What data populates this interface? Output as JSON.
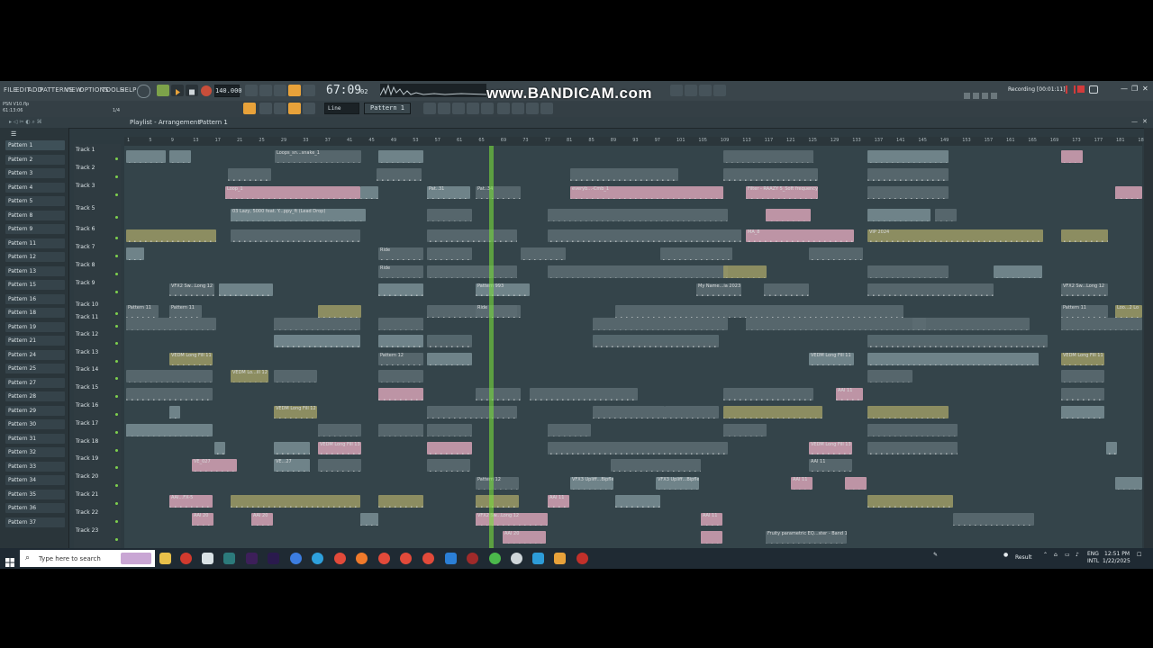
{
  "window": {
    "project_file": "PSN V10.flp",
    "project_time": "61:13:06",
    "bpm": "140.000",
    "time": "67:09",
    "time_small": "02",
    "watermark": "www.BANDICAM.com",
    "recording_label": "Recording [00:01:11]",
    "time_sig": "1/4"
  },
  "menu": [
    "FILE",
    "EDIT",
    "ADD",
    "PATTERNS",
    "VIEW",
    "OPTIONS",
    "TOOLS",
    "HELP"
  ],
  "toolbar": {
    "snap": "Line",
    "pattern": "Pattern 1"
  },
  "playlist": {
    "breadcrumb": "Playlist - Arrangement",
    "pattern": "Pattern 1"
  },
  "patterns": [
    "Pattern 1",
    "Pattern 2",
    "Pattern 3",
    "Pattern 4",
    "Pattern 5",
    "Pattern 8",
    "Pattern 9",
    "Pattern 11",
    "Pattern 12",
    "Pattern 13",
    "Pattern 15",
    "Pattern 16",
    "Pattern 18",
    "Pattern 19",
    "Pattern 21",
    "Pattern 24",
    "Pattern 25",
    "Pattern 27",
    "Pattern 28",
    "Pattern 29",
    "Pattern 30",
    "Pattern 31",
    "Pattern 32",
    "Pattern 33",
    "Pattern 34",
    "Pattern 35",
    "Pattern 36",
    "Pattern 37"
  ],
  "tracks": [
    "Track 1",
    "Track 2",
    "Track 3",
    "Track 5",
    "Track 6",
    "Track 7",
    "Track 8",
    "Track 9",
    "Track 10",
    "Track 11",
    "Track 12",
    "Track 13",
    "Track 14",
    "Track 15",
    "Track 16",
    "Track 17",
    "Track 18",
    "Track 19",
    "Track 20",
    "Track 21",
    "Track 22",
    "Track 23"
  ],
  "ruler": [
    "1",
    "5",
    "9",
    "13",
    "17",
    "21",
    "25",
    "29",
    "33",
    "37",
    "41",
    "45",
    "49",
    "53",
    "57",
    "61",
    "65",
    "69",
    "73",
    "77",
    "81",
    "85",
    "89",
    "93",
    "97",
    "101",
    "105",
    "109",
    "113",
    "117",
    "121",
    "125",
    "129",
    "133",
    "137",
    "141",
    "145",
    "149",
    "153",
    "157",
    "161",
    "165",
    "169",
    "173",
    "177",
    "181",
    "185"
  ],
  "clip_labels": {
    "snake": "Loops_sn...snake_1",
    "loop": "Loop_1",
    "pat31": "Pat..31",
    "pat34": "Pat..34",
    "everyb": "everyb...-Cmb_1",
    "filter": "Filter - RAAZY 5_Soft frequency",
    "lazy1": "03 Lazy, 5000 feat. Y...ppy_ft (Lead Drop)",
    "lazy2": "03 Lazy...ead Drop)",
    "vip": "VIP 2024",
    "ma": "MA_8",
    "ride": "Ride",
    "vfx": "VFX2 Sw...Long 12",
    "pattern993": "Pattern 993",
    "myname": "My Name...ia 2023",
    "pattern11": "Pattern 11",
    "edm1": "VEDM Long Fill 11",
    "edm2": "VEDM Lo...ill 12",
    "edm3": "VEDM Long Fill 12",
    "edm4": "VEDM Long Fill 13",
    "pattern12": "Pattern 12",
    "ve": "VE_027",
    "ve2": "VE...27",
    "aai": "AAI 11",
    "aai2": "AAI 20",
    "aai3": "AAI...FX-5",
    "vfx3": "VFX3 Upliff...Bipfler",
    "fruity": "Fruity parametric EQ...ster - Band 1 freq",
    "loop2": "Loo...2 Lo"
  },
  "taskbar": {
    "search_placeholder": "Type here to search",
    "result": "Result",
    "lang1": "ENG",
    "lang2": "INTL",
    "clock_time": "12:51 PM",
    "clock_date": "1/22/2025"
  },
  "colors": {
    "app_bg": "#2d3a40",
    "grid_bg": "#34444a",
    "clip_pink": "#d6a3b6",
    "clip_grey": "#7a8e95",
    "clip_olive": "#9c9a66",
    "playhead": "#78dc3c",
    "toolbar_orange": "#e8a23a"
  }
}
